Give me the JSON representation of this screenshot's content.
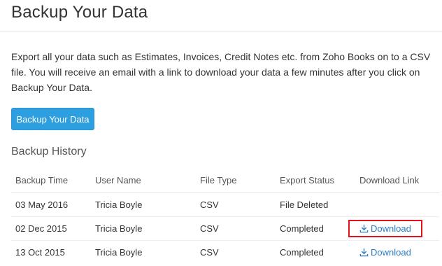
{
  "page": {
    "title": "Backup Your Data",
    "description": "Export all your data such as Estimates, Invoices, Credit Notes etc. from Zoho Books on to a CSV file. You will receive an email with a link to download your data a few minutes after you click on Backup Your Data.",
    "backup_button_label": "Backup Your Data"
  },
  "history": {
    "title": "Backup History",
    "columns": [
      "Backup Time",
      "User Name",
      "File Type",
      "Export Status",
      "Download Link"
    ],
    "rows": [
      {
        "time": "03 May 2016",
        "user": "Tricia Boyle",
        "file_type": "CSV",
        "status": "File Deleted",
        "download_label": ""
      },
      {
        "time": "02 Dec 2015",
        "user": "Tricia Boyle",
        "file_type": "CSV",
        "status": "Completed",
        "download_label": "Download"
      },
      {
        "time": "13 Oct 2015",
        "user": "Tricia Boyle",
        "file_type": "CSV",
        "status": "Completed",
        "download_label": "Download"
      }
    ]
  },
  "colors": {
    "primary_button": "#2d9ee0",
    "link": "#2d7bc4",
    "status_deleted": "#c0392b",
    "status_completed": "#2e7d32",
    "highlight_box": "#e0141e"
  },
  "icons": {
    "download": "download-icon"
  }
}
